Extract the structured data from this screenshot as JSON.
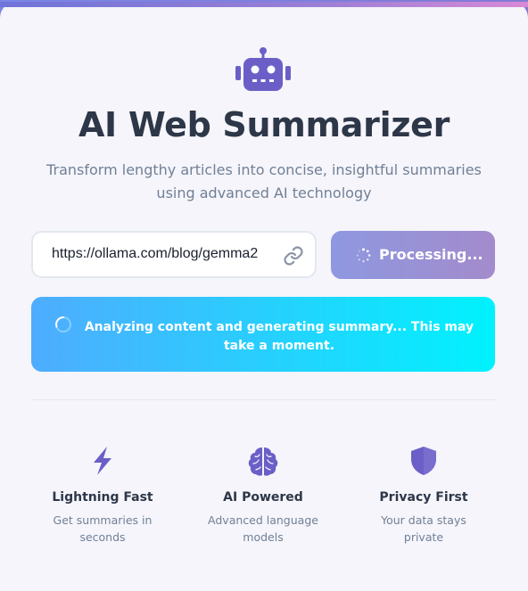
{
  "header": {
    "title": "AI Web Summarizer",
    "subtitle": "Transform lengthy articles into concise, insightful summaries using advanced AI technology",
    "icon": "robot-icon"
  },
  "form": {
    "url_value": "https://ollama.com/blog/gemma2",
    "url_icon": "link-icon",
    "button_label": "Processing...",
    "button_state": "loading"
  },
  "status": {
    "message": "Analyzing content and generating summary... This may take a moment."
  },
  "features": [
    {
      "icon": "lightning-icon",
      "title": "Lightning Fast",
      "desc_line1": "Get summaries in",
      "desc_line2": "seconds"
    },
    {
      "icon": "brain-icon",
      "title": "AI Powered",
      "desc_line1": "Advanced language",
      "desc_line2": "models"
    },
    {
      "icon": "shield-icon",
      "title": "Privacy First",
      "desc_line1": "Your data stays",
      "desc_line2": "private"
    }
  ],
  "colors": {
    "accent": "#6b5fc7",
    "title": "#2d3748",
    "muted": "#718096",
    "status_gradient_start": "#4facfe",
    "status_gradient_end": "#00f2fe"
  }
}
